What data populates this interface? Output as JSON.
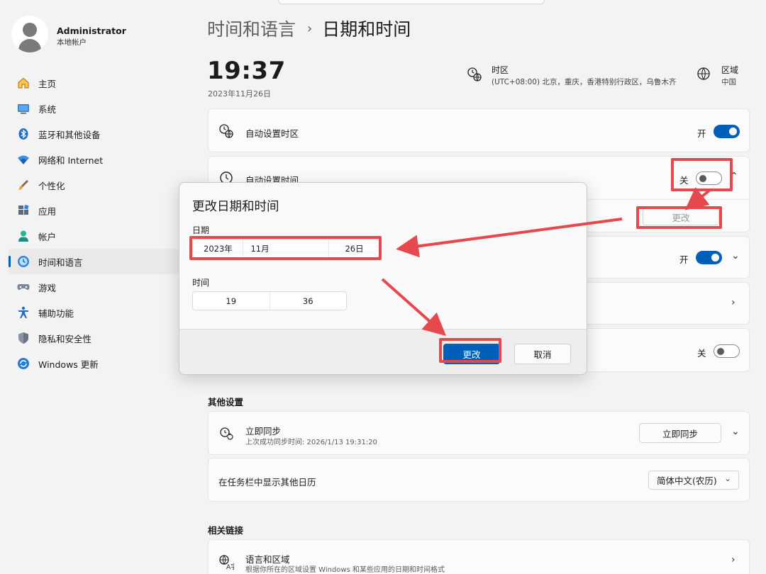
{
  "user": {
    "name": "Administrator",
    "account_type": "本地帐户"
  },
  "nav": [
    {
      "label": "主页",
      "icon": "home-icon"
    },
    {
      "label": "系统",
      "icon": "system-icon"
    },
    {
      "label": "蓝牙和其他设备",
      "icon": "bluetooth-icon"
    },
    {
      "label": "网络和 Internet",
      "icon": "wifi-icon"
    },
    {
      "label": "个性化",
      "icon": "brush-icon"
    },
    {
      "label": "应用",
      "icon": "apps-icon"
    },
    {
      "label": "帐户",
      "icon": "account-icon"
    },
    {
      "label": "时间和语言",
      "icon": "time-language-icon",
      "active": true
    },
    {
      "label": "游戏",
      "icon": "gamepad-icon"
    },
    {
      "label": "辅助功能",
      "icon": "accessibility-icon"
    },
    {
      "label": "隐私和安全性",
      "icon": "shield-icon"
    },
    {
      "label": "Windows 更新",
      "icon": "update-icon"
    }
  ],
  "header": {
    "parent": "时间和语言",
    "separator": "›",
    "current": "日期和时间"
  },
  "clock": {
    "time": "19:37",
    "date": "2023年11月26日"
  },
  "timezone": {
    "label": "时区",
    "value": "(UTC+08:00) 北京，重庆，香港特别行政区，乌鲁木齐"
  },
  "region": {
    "label": "区域",
    "value": "中国"
  },
  "settings": {
    "auto_timezone": {
      "label": "自动设置时区",
      "state": "开"
    },
    "auto_time": {
      "label": "自动设置时间",
      "state": "关"
    },
    "manual_change_button": "更改",
    "dst_state": "开",
    "show_time_state": "关"
  },
  "dialog": {
    "title": "更改日期和时间",
    "date_label": "日期",
    "year": "2023年",
    "month": "11月",
    "day": "26日",
    "time_label": "时间",
    "hour": "19",
    "minute": "36",
    "primary_button": "更改",
    "cancel_button": "取消"
  },
  "other_settings": {
    "title": "其他设置",
    "sync_label": "立即同步",
    "sync_sub": "上次成功同步时间: 2026/1/13 19:31:20",
    "sync_button": "立即同步",
    "calendar_label": "在任务栏中显示其他日历",
    "calendar_value": "简体中文(农历)"
  },
  "related_links": {
    "title": "相关链接",
    "lang_label": "语言和区域",
    "lang_sub": "根据你所在的区域设置 Windows 和某些应用的日期和时间格式"
  },
  "colors": {
    "accent": "#005fb8",
    "annotation": "#e5484d",
    "background": "#f3f3f3"
  }
}
